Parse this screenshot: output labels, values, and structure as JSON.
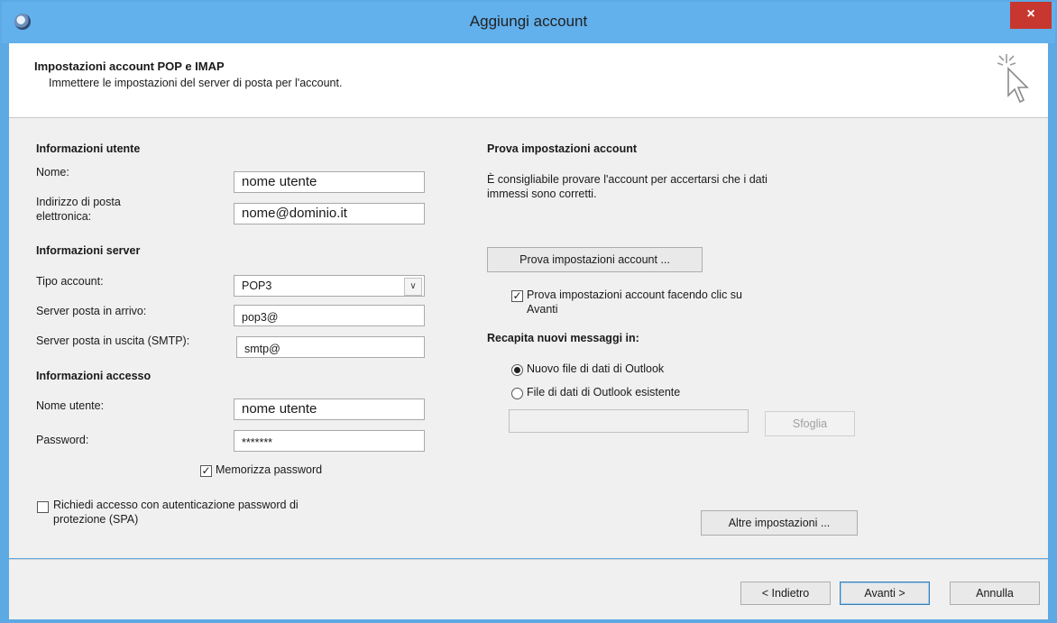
{
  "window": {
    "title": "Aggiungi account",
    "close_glyph": "×",
    "accent_color": "#62b0ec",
    "close_color": "#c7372f"
  },
  "header": {
    "title": "Impostazioni account POP e IMAP",
    "subtitle": "Immettere le impostazioni del server di posta per l'account."
  },
  "user_info": {
    "heading": "Informazioni utente",
    "name_label": "Nome:",
    "name_value": "nome utente",
    "email_label_1": "Indirizzo di posta",
    "email_label_2": "elettronica:",
    "email_value": "nome@dominio.it"
  },
  "server_info": {
    "heading": "Informazioni server",
    "account_type_label": "Tipo account:",
    "account_type_value": "POP3",
    "incoming_label": "Server posta in arrivo:",
    "incoming_value": "pop3@",
    "outgoing_label": "Server posta in uscita (SMTP):",
    "outgoing_value": "smtp@"
  },
  "login_info": {
    "heading": "Informazioni accesso",
    "username_label": "Nome utente:",
    "username_value": "nome utente",
    "password_label": "Password:",
    "password_value": "*******",
    "remember_label": "Memorizza password",
    "remember_checked": true,
    "spa_label_1": "Richiedi accesso con autenticazione password di",
    "spa_label_2": "protezione (SPA)",
    "spa_checked": false
  },
  "test_settings": {
    "heading": "Prova impostazioni account",
    "description_1": "È consigliabile provare l'account per accertarsi che i dati",
    "description_2": "immessi sono corretti.",
    "test_button": "Prova impostazioni account ...",
    "auto_test_label_1": "Prova impostazioni account facendo clic su",
    "auto_test_label_2": "Avanti",
    "auto_test_checked": true
  },
  "delivery": {
    "heading": "Recapita nuovi messaggi in:",
    "option_new": "Nuovo file di dati di Outlook",
    "option_existing": "File di dati di Outlook esistente",
    "selected": "new",
    "browse_button": "Sfoglia",
    "more_settings_button": "Altre impostazioni ..."
  },
  "footer": {
    "back_button": "< Indietro",
    "next_button": "Avanti >",
    "cancel_button": "Annulla"
  },
  "icons": {
    "app": "outlook-app-icon",
    "close": "close-icon",
    "header": "cursor-sparkle-icon",
    "dropdown": "chevron-down-icon",
    "check": "checkmark-icon"
  }
}
